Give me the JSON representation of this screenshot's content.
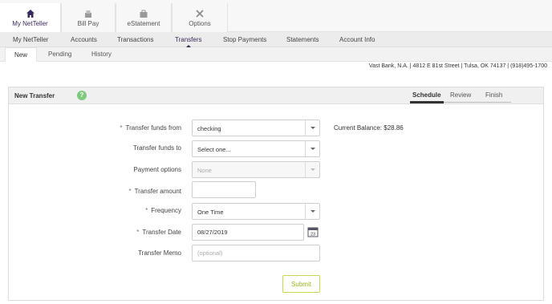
{
  "topnav": [
    {
      "label": "My NetTeller",
      "icon": "home-icon"
    },
    {
      "label": "Bill Pay",
      "icon": "bill-pay-icon"
    },
    {
      "label": "eStatement",
      "icon": "briefcase-icon"
    },
    {
      "label": "Options",
      "icon": "tools-icon"
    }
  ],
  "mainnav": [
    "My NetTeller",
    "Accounts",
    "Transactions",
    "Transfers",
    "Stop Payments",
    "Statements",
    "Account Info"
  ],
  "subnav": [
    "New",
    "Pending",
    "History"
  ],
  "bank_info": "Vast Bank, N.A. | 4812 E 81st Street | Tulsa, OK 74137 | (918)495-1700",
  "panel": {
    "title": "New Transfer",
    "help": "?",
    "steps": [
      "Schedule",
      "Review",
      "Finish"
    ]
  },
  "form": {
    "from_label": "Transfer funds from",
    "from_value": "checking",
    "balance": "Current Balance: $28.86",
    "to_label": "Transfer funds to",
    "to_value": "Select one...",
    "payment_label": "Payment options",
    "payment_value": "None",
    "amount_label": "Transfer amount",
    "amount_value": "",
    "frequency_label": "Frequency",
    "frequency_value": "One Time",
    "date_label": "Transfer Date",
    "date_value": "08/27/2019",
    "calendar_day": "23",
    "memo_label": "Transfer Memo",
    "memo_placeholder": "(optional)",
    "required_mark": "*",
    "submit_label": "Submit"
  },
  "colors": {
    "accent": "#3a2a5c",
    "submit": "#98b320",
    "help": "#7ecb7e"
  }
}
